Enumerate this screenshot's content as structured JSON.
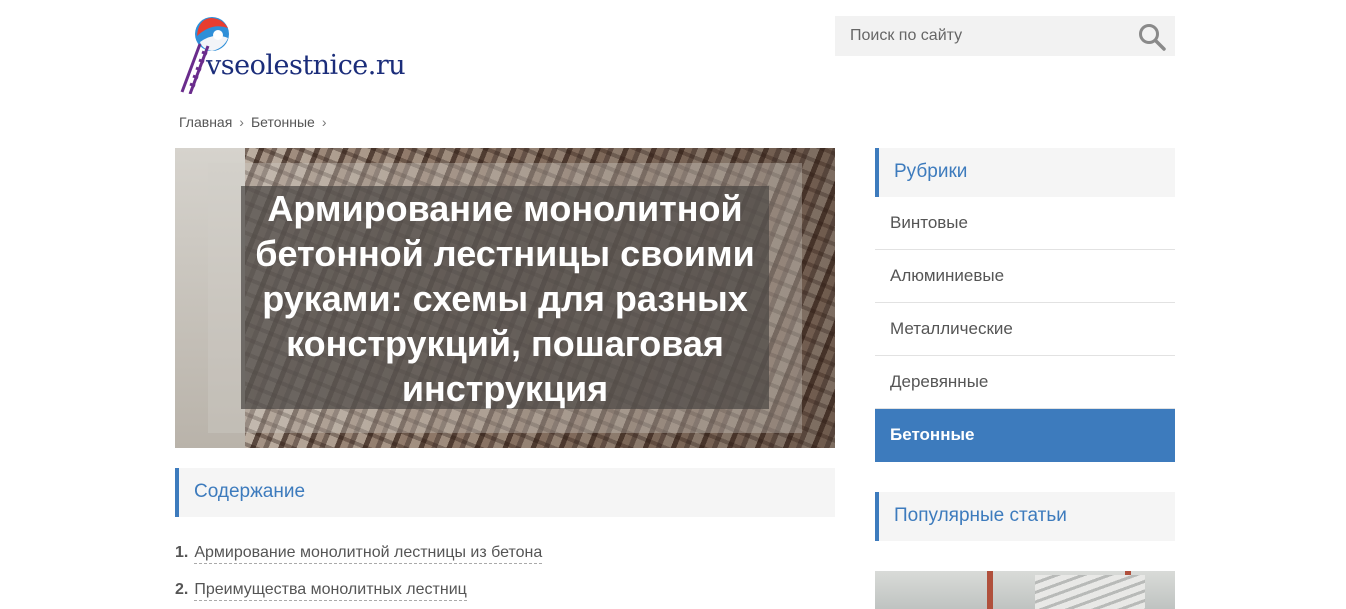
{
  "header": {
    "logo_text": "vseolestnice.ru",
    "search_placeholder": "Поиск по сайту",
    "search_icon": "search-icon"
  },
  "breadcrumb": {
    "items": [
      "Главная",
      "Бетонные"
    ],
    "separator": "›"
  },
  "article": {
    "title": "Армирование монолитной бетонной лестницы своими руками: схемы для разных конструкций, пошаговая инструкция"
  },
  "toc": {
    "heading": "Содержание",
    "items": [
      {
        "num": "1.",
        "label": "Армирование монолитной лестницы из бетона"
      },
      {
        "num": "2.",
        "label": "Преимущества монолитных лестниц"
      }
    ]
  },
  "sidebar": {
    "rubrics_heading": "Рубрики",
    "categories": [
      {
        "label": "Винтовые",
        "active": false
      },
      {
        "label": "Алюминиевые",
        "active": false
      },
      {
        "label": "Металлические",
        "active": false
      },
      {
        "label": "Деревянные",
        "active": false
      },
      {
        "label": "Бетонные",
        "active": true
      }
    ],
    "popular_heading": "Популярные статьи"
  },
  "colors": {
    "accent": "#3d7bbd",
    "panel_bg": "#f5f5f5",
    "logo_text": "#1b2d7a"
  }
}
